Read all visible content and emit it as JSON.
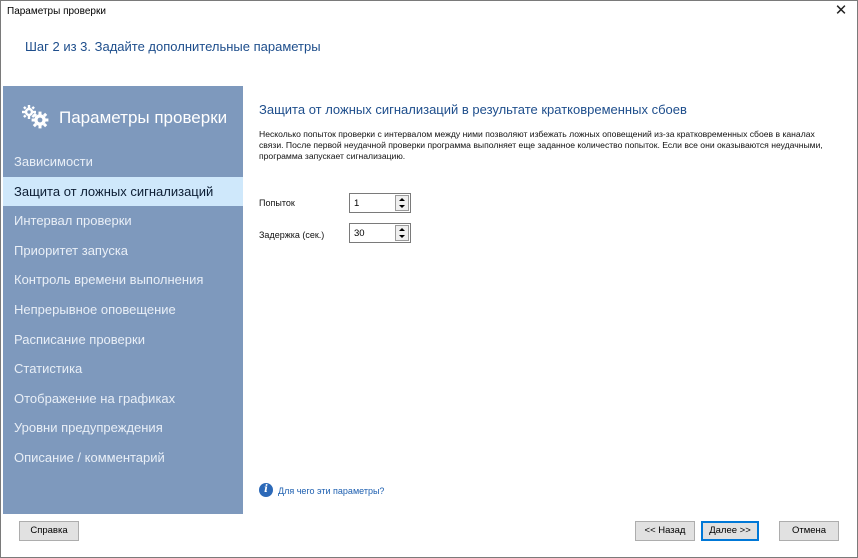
{
  "window": {
    "title": "Параметры проверки",
    "close_glyph": "✕"
  },
  "step_title": "Шаг 2 из 3. Задайте дополнительные параметры",
  "sidebar": {
    "header_icon": "gears-icon",
    "title": "Параметры проверки",
    "items": [
      {
        "label": "Зависимости",
        "active": false
      },
      {
        "label": "Защита от ложных сигнализаций",
        "active": true
      },
      {
        "label": "Интервал проверки",
        "active": false
      },
      {
        "label": "Приоритет запуска",
        "active": false
      },
      {
        "label": "Контроль времени выполнения",
        "active": false
      },
      {
        "label": "Непрерывное оповещение",
        "active": false
      },
      {
        "label": "Расписание проверки",
        "active": false
      },
      {
        "label": "Статистика",
        "active": false
      },
      {
        "label": "Отображение на графиках",
        "active": false
      },
      {
        "label": "Уровни предупреждения",
        "active": false
      },
      {
        "label": "Описание / комментарий",
        "active": false
      }
    ]
  },
  "content": {
    "title": "Защита от ложных сигнализаций в результате кратковременных сбоев",
    "description": "Несколько попыток проверки с интервалом между ними позволяют избежать ложных оповещений из-за кратковременных сбоев в каналах связи. После первой неудачной проверки программа выполняет еще заданное количество попыток. Если все они оказываются неудачными, программа запускает сигнализацию.",
    "fields": {
      "attempts": {
        "label": "Попыток",
        "value": "1"
      },
      "delay": {
        "label": "Задержка (сек.)",
        "value": "30"
      }
    },
    "help_link": "Для чего эти параметры?"
  },
  "buttons": {
    "help": "Справка",
    "back": "<< Назад",
    "next": "Далее >>",
    "cancel": "Отмена"
  },
  "colors": {
    "sidebar_bg": "#7e99bd",
    "sidebar_active": "#cfe8fb",
    "heading": "#1e4e8c",
    "link": "#1d5fb0",
    "default_button_border": "#0078d7"
  }
}
